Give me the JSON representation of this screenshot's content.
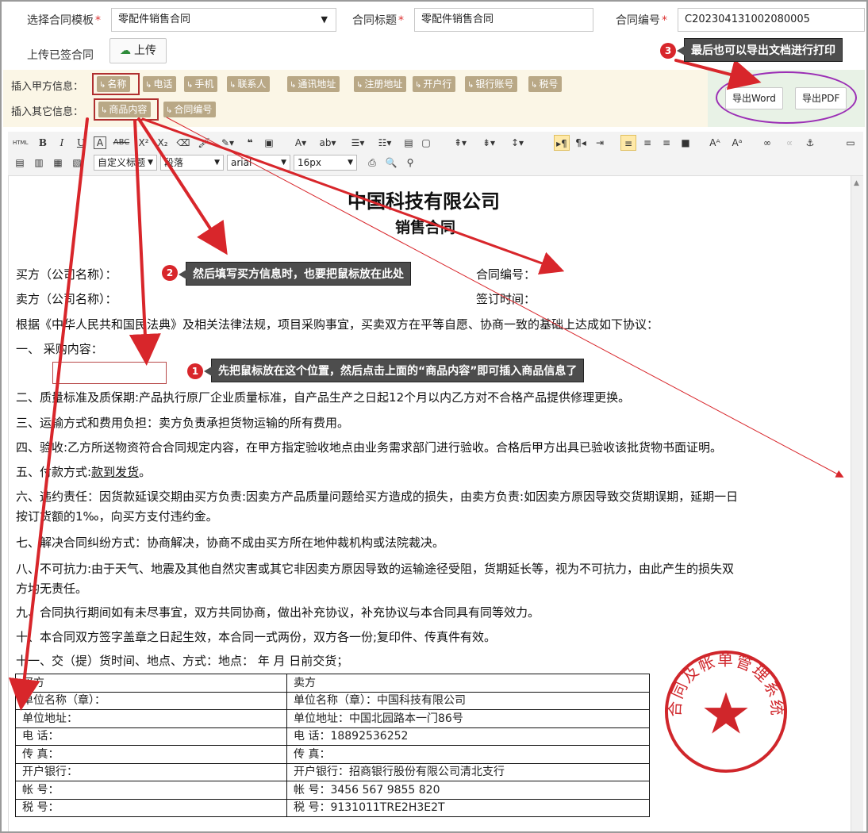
{
  "form": {
    "template_label": "选择合同模板",
    "template_value": "零配件销售合同",
    "title_label": "合同标题",
    "title_value": "零配件销售合同",
    "number_label": "合同编号",
    "number_value": "C202304131002080005",
    "required_mark": "*",
    "signed_label": "上传已签合同",
    "upload_button": "上传"
  },
  "insert_bar": {
    "party_a_label": "插入甲方信息：",
    "party_a_tags": [
      "名称",
      "电话",
      "手机",
      "联系人",
      "通讯地址",
      "注册地址",
      "开户行",
      "银行账号",
      "税号"
    ],
    "other_label": "插入其它信息：",
    "other_tags": [
      "商品内容",
      "合同编号"
    ],
    "tag_arrow": "↳",
    "export_word": "导出Word",
    "export_pdf": "导出PDF"
  },
  "toolbar": {
    "style_select": "自定义标题",
    "paragraph_select": "段落",
    "font_select": "arial",
    "size_select": "16px"
  },
  "document": {
    "company": "中国科技有限公司",
    "doc_title": "销售合同",
    "buyer_label": "买方（公司名称）：",
    "seller_label": "卖方（公司名称）：",
    "contract_no_label": "合同编号：",
    "sign_time_label": "签订时间：",
    "intro": "根据《中华人民共和国民法典》及相关法律法规，项目采购事宜，买卖双方在平等自愿、协商一致的基础上达成如下协议：",
    "clause1": "一、   采购内容：",
    "clause2": "二、质量标准及质保期:产品执行原厂企业质量标准，自产品生产之日起12个月以内乙方对不合格产品提供修理更换。",
    "clause3": "三、运输方式和费用负担：卖方负责承担货物运输的所有费用。",
    "clause4": "四、验收:乙方所送物资符合合同规定内容，在甲方指定验收地点由业务需求部门进行验收。合格后甲方出具已验收该批货物书面证明。",
    "clause5_prefix": "五、付款方式:",
    "clause5_value": "款到发货",
    "clause5_suffix": "。",
    "clause6_line1": "六、违约责任：因货款延误交期由买方负责:因卖方产品质量问题给买方造成的损失，由卖方负责:如因卖方原因导致交货期误期，延期一日",
    "clause6_line2": "按订货额的1‰，向买方支付违约金。",
    "clause7": "七、解决合同纠纷方式：协商解决，协商不成由买方所在地仲裁机构或法院裁决。",
    "clause8_line1": "八、不可抗力:由于天气、地震及其他自然灾害或其它非因卖方原因导致的运输途径受阻，货期延长等，视为不可抗力，由此产生的损失双",
    "clause8_line2": "方均无责任。",
    "clause9": "九、合同执行期间如有未尽事宜，双方共同协商，做出补充协议，补充协议与本合同具有同等效力。",
    "clause10": "十、本合同双方签字盖章之日起生效，本合同一式两份，双方各一份;复印件、传真件有效。",
    "clause11": "十一、交（提）货时间、地点、方式：地点：    年    月    日前交货；",
    "table": [
      [
        "买方",
        "卖方"
      ],
      [
        "单位名称（章）：",
        "单位名称（章）：中国科技有限公司"
      ],
      [
        "单位地址：",
        "单位地址：中国北园路本一门86号"
      ],
      [
        "电      话：",
        "电      话：18892536252"
      ],
      [
        "传      真：",
        "传      真："
      ],
      [
        "开户银行：",
        "开户银行：招商银行股份有限公司清北支行"
      ],
      [
        "帐      号：",
        "帐      号：3456 567 9855 820"
      ],
      [
        "税      号：",
        "税      号：9131011TRE2H3E2T"
      ]
    ]
  },
  "callouts": {
    "c1_num": "1",
    "c1_text": "先把鼠标放在这个位置，然后点击上面的“商品内容”即可插入商品信息了",
    "c2_num": "2",
    "c2_text": "然后填写买方信息时，也要把鼠标放在此处",
    "c3_num": "3",
    "c3_text": "最后也可以导出文档进行打印"
  },
  "seal": {
    "text": "合同及帐单管理系统",
    "color": "#d0262b"
  },
  "colors": {
    "arrow": "#d8262b",
    "tag_bg": "#b9a886",
    "highlight_ellipse": "#9b2fb5"
  }
}
